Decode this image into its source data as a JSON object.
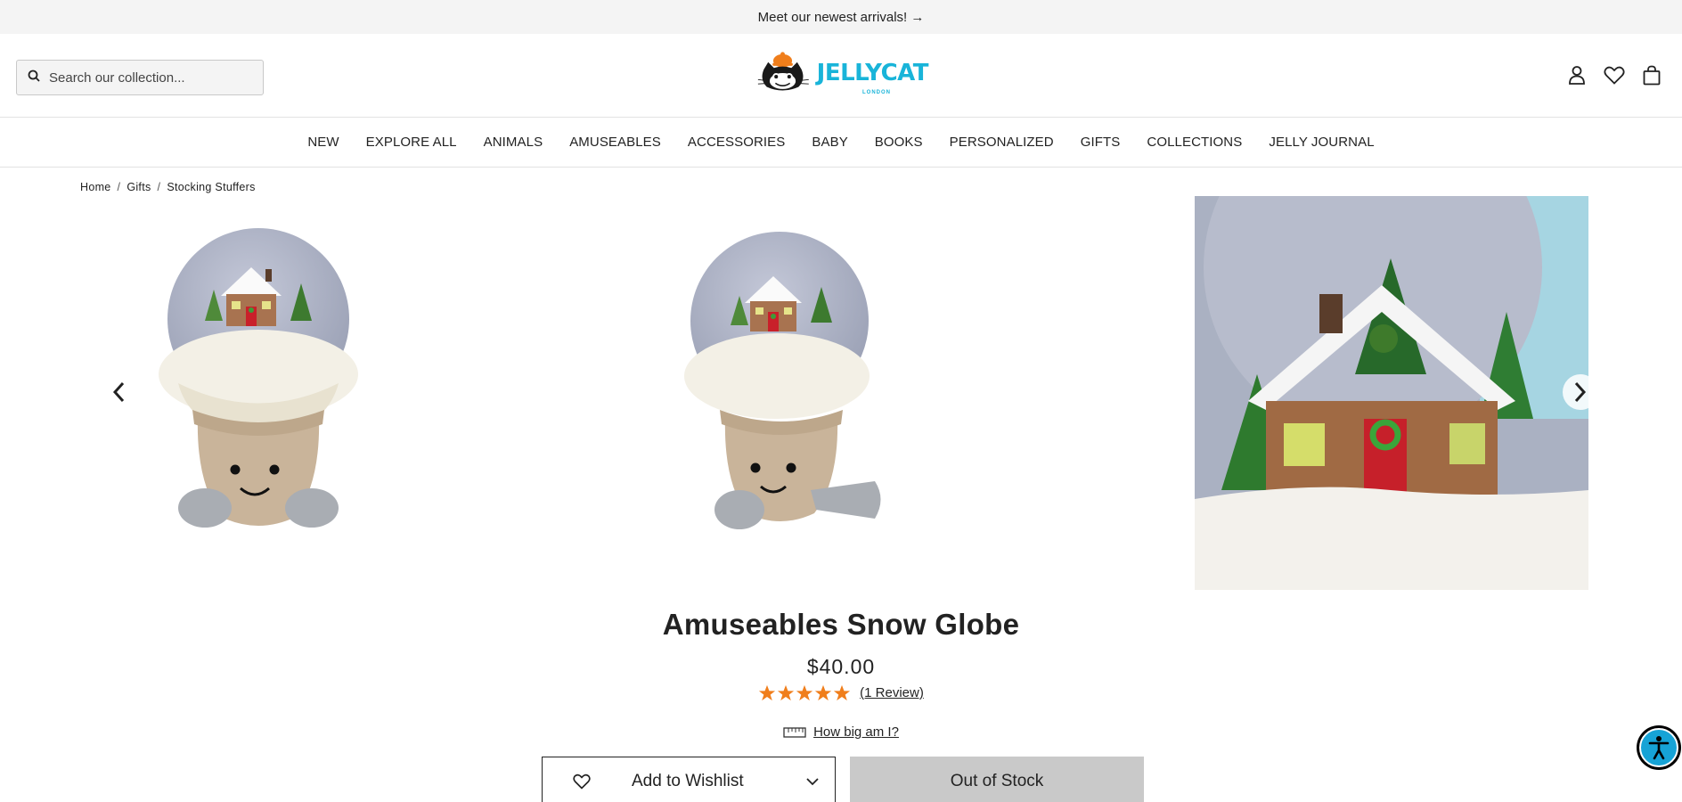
{
  "announcement": {
    "text": "Meet our newest arrivals! →"
  },
  "header": {
    "search_placeholder": "Search our collection...",
    "logo_text": "JELLYCAT",
    "logo_sub": "LONDON",
    "icons": [
      "user-icon",
      "heart-icon",
      "bag-icon"
    ]
  },
  "nav": {
    "items": [
      "NEW",
      "EXPLORE ALL",
      "ANIMALS",
      "AMUSEABLES",
      "ACCESSORIES",
      "BABY",
      "BOOKS",
      "PERSONALIZED",
      "GIFTS",
      "COLLECTIONS",
      "JELLY JOURNAL"
    ]
  },
  "breadcrumb": {
    "items": [
      "Home",
      "Gifts",
      "Stocking Stuffers"
    ],
    "separator": "/"
  },
  "product": {
    "title": "Amuseables Snow Globe",
    "price": "$40.00",
    "rating": 5,
    "reviews": "(1 Review)",
    "size_link": "How big am I?",
    "wishlist_label": "Add to Wishlist",
    "stock_label": "Out of Stock"
  },
  "colors": {
    "brand": "#19b4d9",
    "star": "#f07e1b",
    "button_disabled": "#c9c9c9",
    "accessibility": "#16a3d6"
  }
}
